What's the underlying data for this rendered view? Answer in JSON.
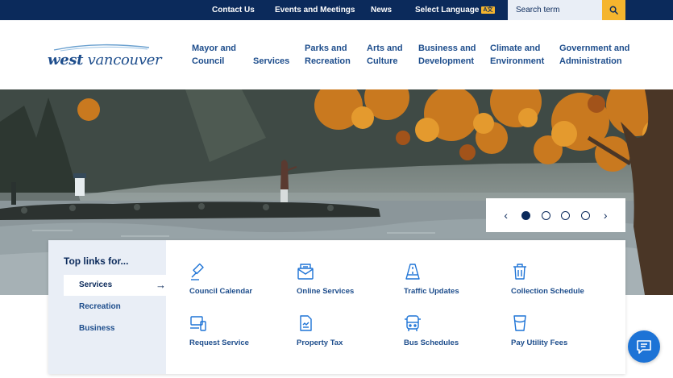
{
  "utility_bar": {
    "links": [
      "Contact Us",
      "Events and Meetings",
      "News"
    ],
    "language_label": "Select Language",
    "language_badge": "A文",
    "search_placeholder": "Search term",
    "search_icon": "search-icon"
  },
  "header": {
    "logo": {
      "word_bold": "west",
      "word_rest": " vancouver"
    },
    "nav": [
      "Mayor and\nCouncil",
      "Services",
      "Parks and\nRecreation",
      "Arts and\nCulture",
      "Business and\nDevelopment",
      "Climate and\nEnvironment",
      "Government and\nAdministration"
    ]
  },
  "hero": {
    "slide_count": 4,
    "active_slide": 1,
    "prev_icon": "chevron-left-icon",
    "next_icon": "chevron-right-icon"
  },
  "top_links": {
    "title": "Top links for...",
    "tabs": [
      "Services",
      "Recreation",
      "Business"
    ],
    "active_tab": "Services",
    "links": [
      {
        "label": "Council Calendar",
        "icon": "gavel-icon"
      },
      {
        "label": "Online Services",
        "icon": "mail-icon"
      },
      {
        "label": "Traffic Updates",
        "icon": "road-icon"
      },
      {
        "label": "Collection Schedule",
        "icon": "trash-bin-icon"
      },
      {
        "label": "Request Service",
        "icon": "devices-icon"
      },
      {
        "label": "Property Tax",
        "icon": "document-icon"
      },
      {
        "label": "Bus Schedules",
        "icon": "bus-icon"
      },
      {
        "label": "Pay Utility Fees",
        "icon": "water-glass-icon"
      }
    ]
  },
  "chat": {
    "icon": "chat-bubble-icon"
  },
  "colors": {
    "navy": "#0b2a5b",
    "accent_yellow": "#f5b52e",
    "link_blue": "#1d4d8c",
    "chat_blue": "#1d73d6"
  }
}
